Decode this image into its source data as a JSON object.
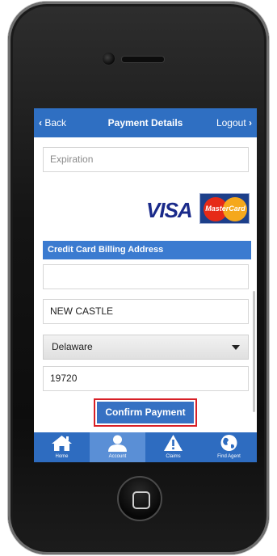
{
  "header": {
    "back_label": "Back",
    "title": "Payment Details",
    "logout_label": "Logout"
  },
  "form": {
    "expiration_placeholder": "Expiration",
    "billing_section_title": "Credit Card Billing Address",
    "address_value": "",
    "city_value": "NEW CASTLE",
    "state_value": "Delaware",
    "zip_value": "19720"
  },
  "cards": {
    "visa_label": "VISA",
    "mastercard_label": "MasterCard"
  },
  "confirm_button_label": "Confirm Payment",
  "tabbar": {
    "items": [
      {
        "label": "Home",
        "icon": "home-icon"
      },
      {
        "label": "Account",
        "icon": "account-icon",
        "active": true
      },
      {
        "label": "Claims",
        "icon": "warning-icon"
      },
      {
        "label": "Find Agent",
        "icon": "globe-icon"
      }
    ]
  },
  "colors": {
    "header_blue": "#2f6fc2",
    "section_blue": "#3b7bd0",
    "confirm_border": "#d81f26",
    "active_tab": "#5a8fd6"
  }
}
